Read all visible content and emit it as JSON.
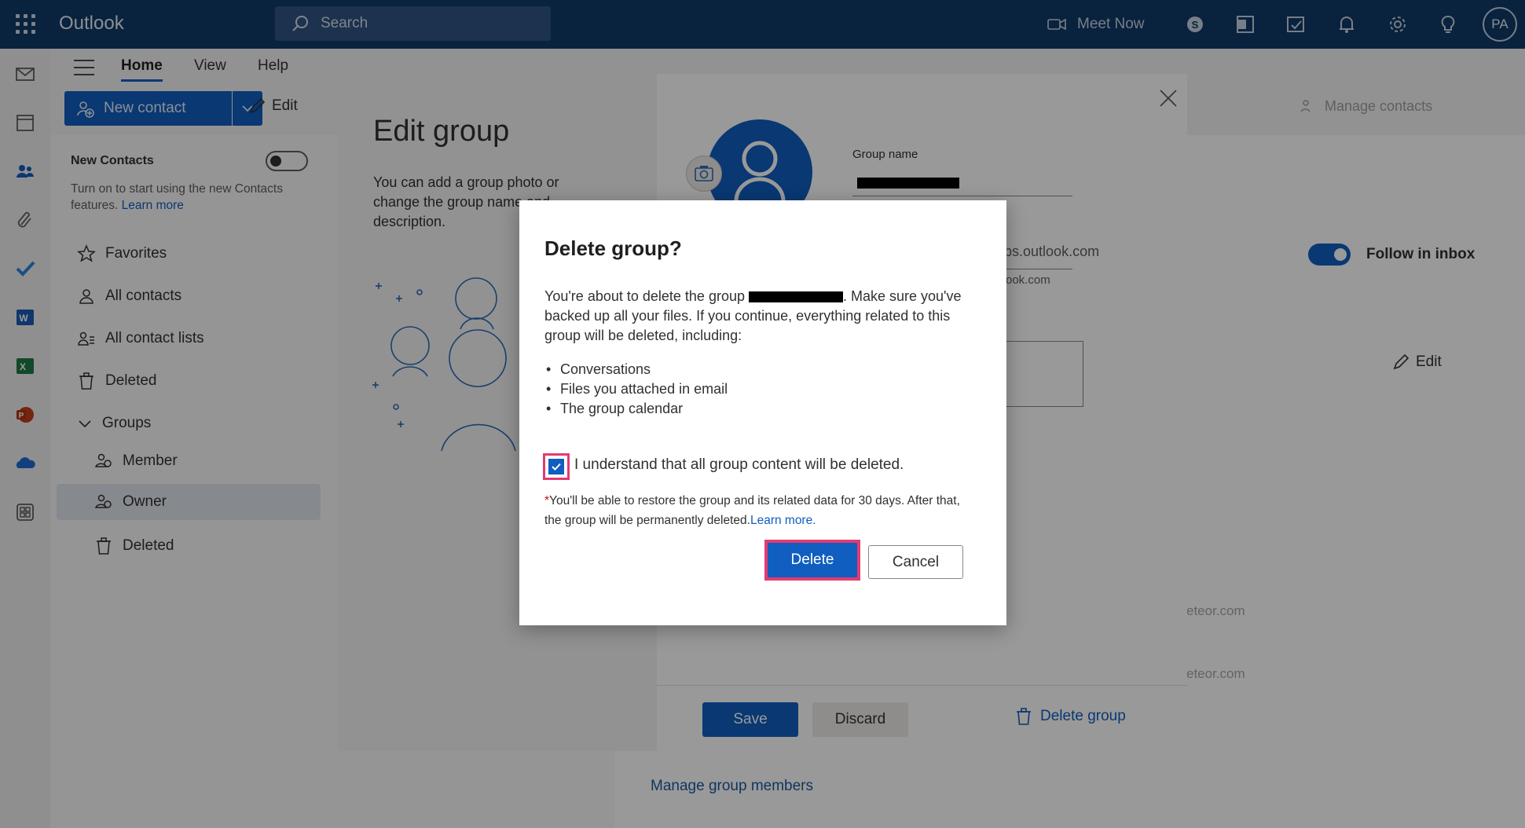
{
  "topbar": {
    "app_title": "Outlook",
    "search_placeholder": "Search",
    "meet_now": "Meet Now",
    "avatar_initials": "PA"
  },
  "ribbon": {
    "tabs": [
      "Home",
      "View",
      "Help"
    ],
    "new_contact": "New contact",
    "edit": "Edit",
    "manage_contacts": "Manage contacts"
  },
  "folders": {
    "new_contacts_label": "New Contacts",
    "new_contacts_desc": "Turn on to start using the new Contacts features.",
    "learn_more": "Learn more",
    "items": [
      {
        "label": "Favorites"
      },
      {
        "label": "All contacts"
      },
      {
        "label": "All contact lists"
      },
      {
        "label": "Deleted"
      },
      {
        "label": "Groups"
      },
      {
        "label": "Member"
      },
      {
        "label": "Owner"
      },
      {
        "label": "Deleted"
      }
    ]
  },
  "background": {
    "follow_in_inbox": "Follow in inbox",
    "edit": "Edit",
    "email_1": "eteor.com",
    "email_2": "eteor.com",
    "manage_group_members": "Manage group members"
  },
  "edit_group": {
    "title": "Edit group",
    "description": "You can add a group photo or change the group name and description.",
    "group_name_label": "Group name",
    "email_suffix": "ups.outlook.com",
    "email_sub": "ook.com",
    "save": "Save",
    "discard": "Discard",
    "delete_group": "Delete group"
  },
  "dialog": {
    "title": "Delete group?",
    "body_before": "You're about to delete the group",
    "body_after": ". Make sure you've backed up all your files. If you continue, everything related to this group will be deleted, including:",
    "list": [
      "Conversations",
      "Files you attached in email",
      "The group calendar"
    ],
    "checkbox_label": "I understand that all group content will be deleted.",
    "checkbox_checked": true,
    "note_star": "*",
    "note": "You'll be able to restore the group and its related data for 30 days. After that, the group will be permanently deleted.",
    "note_link": "Learn more.",
    "delete": "Delete",
    "cancel": "Cancel"
  },
  "colors": {
    "header_bg": "#0f3a68",
    "accent": "#0f5ec0",
    "highlight": "#e43a6f"
  }
}
